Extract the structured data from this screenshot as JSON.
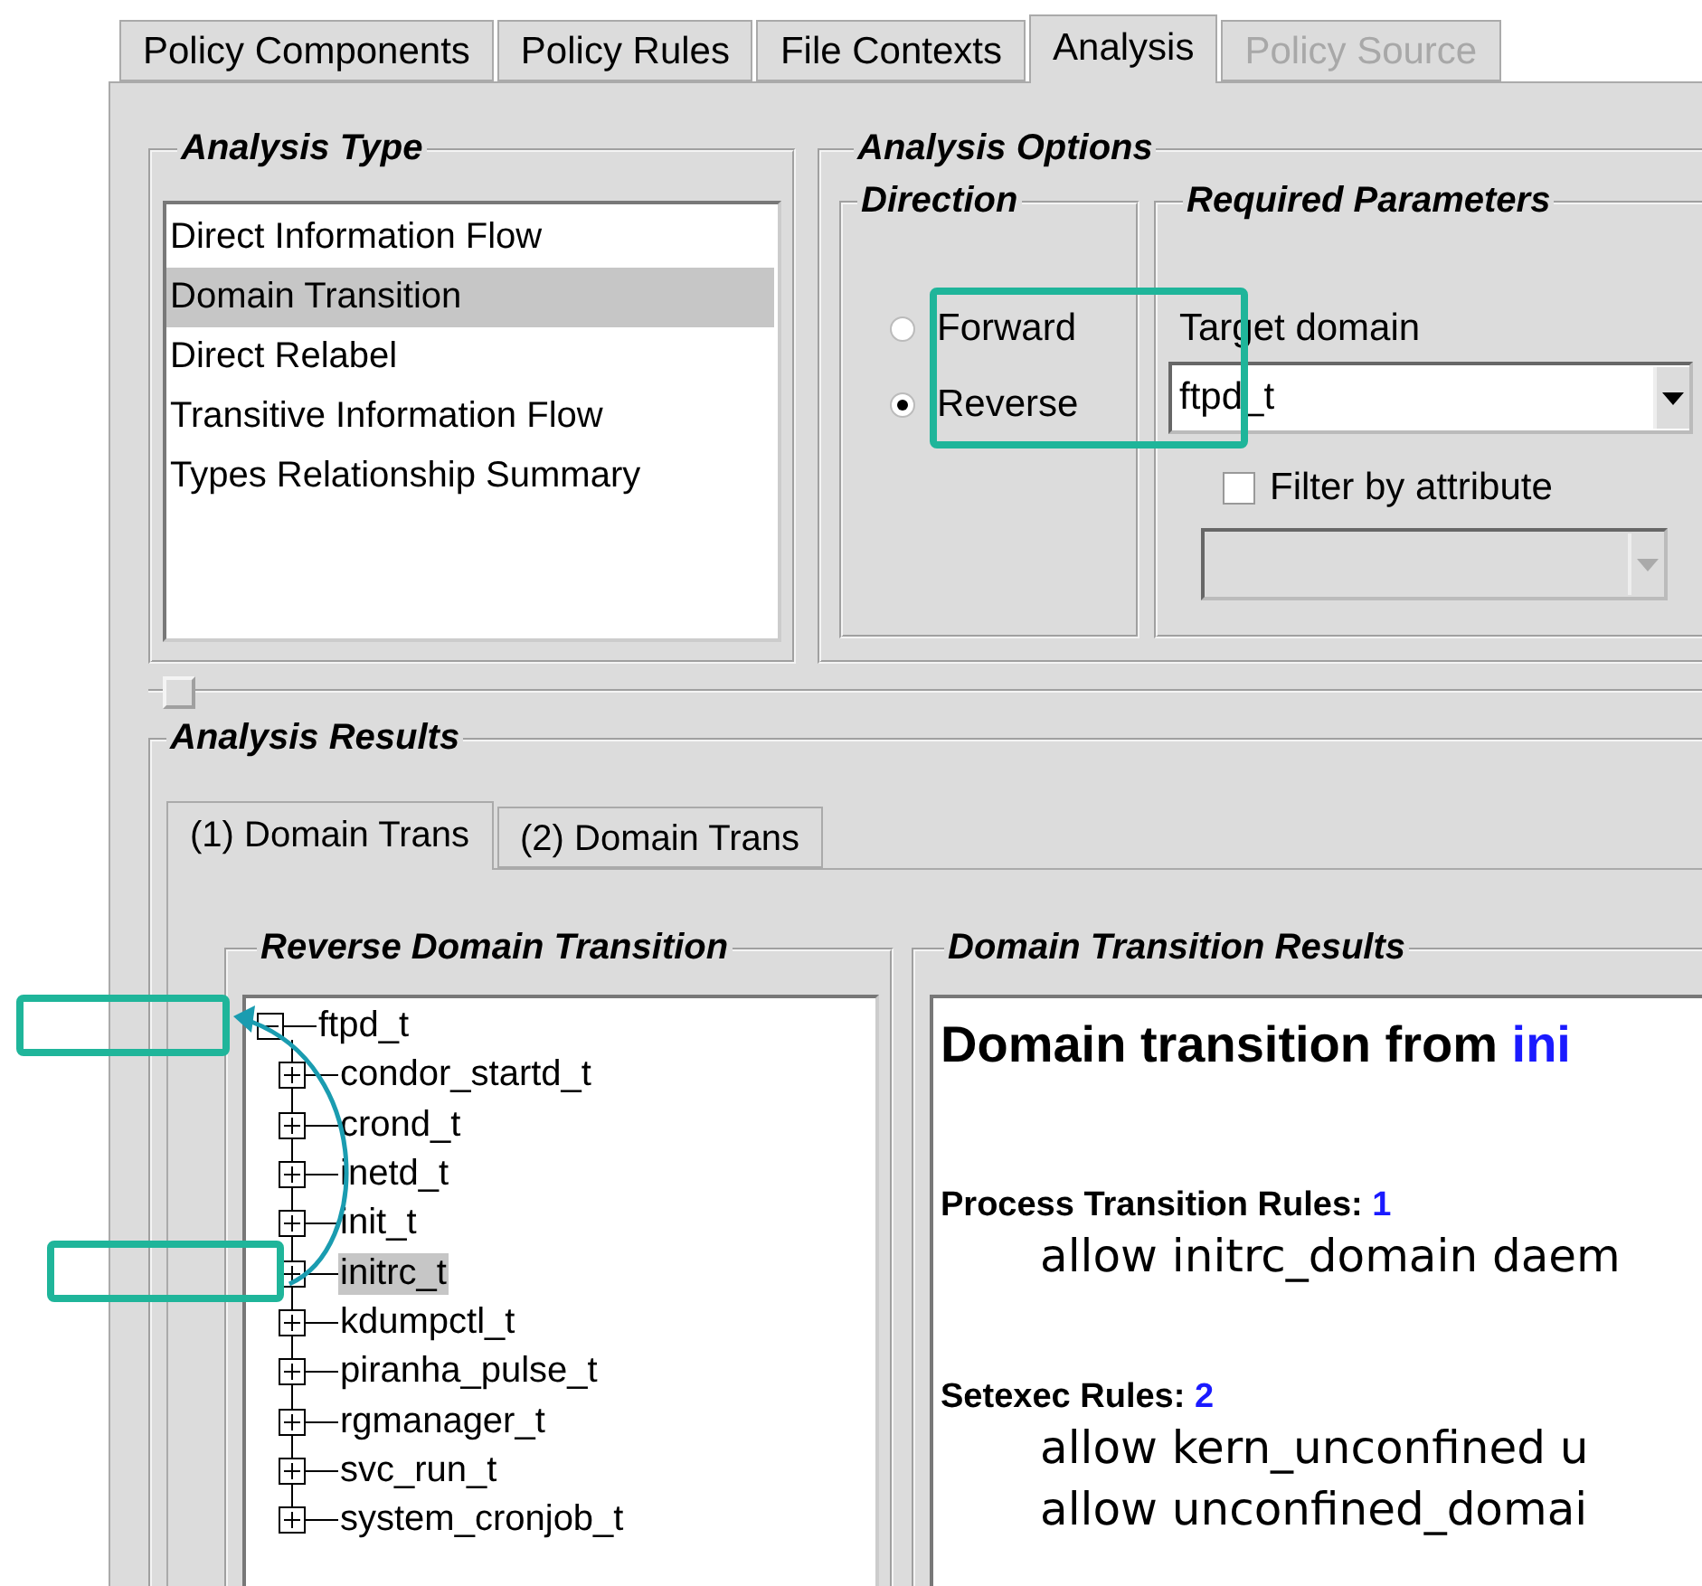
{
  "tabs": [
    {
      "label": "Policy Components",
      "selected": false,
      "disabled": false
    },
    {
      "label": "Policy Rules",
      "selected": false,
      "disabled": false
    },
    {
      "label": "File Contexts",
      "selected": false,
      "disabled": false
    },
    {
      "label": "Analysis",
      "selected": true,
      "disabled": false
    },
    {
      "label": "Policy Source",
      "selected": false,
      "disabled": true
    }
  ],
  "analysis_type": {
    "title": "Analysis Type",
    "items": [
      {
        "label": "Direct Information Flow",
        "selected": false
      },
      {
        "label": "Domain Transition",
        "selected": true
      },
      {
        "label": "Direct Relabel",
        "selected": false
      },
      {
        "label": "Transitive Information Flow",
        "selected": false
      },
      {
        "label": "Types Relationship Summary",
        "selected": false
      }
    ]
  },
  "analysis_options": {
    "title": "Analysis Options",
    "direction": {
      "title": "Direction",
      "options": [
        {
          "label": "Forward",
          "selected": false
        },
        {
          "label": "Reverse",
          "selected": true
        }
      ]
    },
    "required_parameters": {
      "title": "Required Parameters",
      "target_label": "Target domain",
      "target_value": "ftpd_t",
      "filter": {
        "label": "Filter by attribute",
        "checked": false
      },
      "attribute_combo": {
        "disabled": true
      }
    }
  },
  "analysis_results": {
    "title": "Analysis Results",
    "tabs": [
      {
        "label": "(1) Domain Trans",
        "selected": true
      },
      {
        "label": "(2) Domain Trans",
        "selected": false
      }
    ],
    "tree_panel": {
      "title": "Reverse Domain Transition",
      "tree": [
        {
          "label": "ftpd_t",
          "expanded": true,
          "selected": false,
          "children": [
            {
              "label": "condor_startd_t",
              "expanded": false,
              "selected": false
            },
            {
              "label": "crond_t",
              "expanded": false,
              "selected": false
            },
            {
              "label": "inetd_t",
              "expanded": false,
              "selected": false
            },
            {
              "label": "init_t",
              "expanded": false,
              "selected": false
            },
            {
              "label": "initrc_t",
              "expanded": false,
              "selected": true
            },
            {
              "label": "kdumpctl_t",
              "expanded": false,
              "selected": false
            },
            {
              "label": "piranha_pulse_t",
              "expanded": false,
              "selected": false
            },
            {
              "label": "rgmanager_t",
              "expanded": false,
              "selected": false
            },
            {
              "label": "svc_run_t",
              "expanded": false,
              "selected": false
            },
            {
              "label": "system_cronjob_t",
              "expanded": false,
              "selected": false
            }
          ]
        }
      ]
    },
    "results_panel": {
      "title": "Domain Transition Results",
      "heading": "Domain transition from ",
      "heading_target": "ini",
      "sections": [
        {
          "label": "Process Transition Rules:",
          "count": "1",
          "rules": [
            "allow initrc_domain daem"
          ]
        },
        {
          "label": "Setexec Rules:",
          "count": "2",
          "rules": [
            "allow kern_unconfined u",
            "allow unconfined_domai"
          ]
        }
      ]
    }
  }
}
